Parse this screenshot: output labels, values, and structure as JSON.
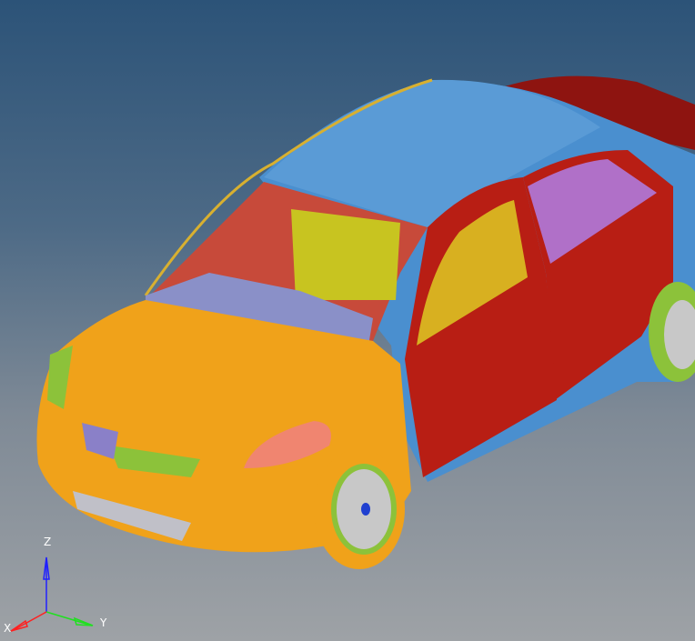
{
  "viewport": {
    "model": "sedan-car-fe-model",
    "colors": {
      "body_side": "#4a8fcf",
      "hood_front": "#f0a21a",
      "doors": "#b81e14",
      "spoiler": "#8e1410",
      "tire": "#f0a21a",
      "rim": "#c8c8c8",
      "headlight": "#f08570",
      "grille_trim": "#8cc23a",
      "rear_glass": "#b070c8",
      "seat": "#c8c420"
    }
  },
  "triad": {
    "x_label": "X",
    "y_label": "Y",
    "z_label": "Z",
    "x_color": "#ff2020",
    "y_color": "#20e020",
    "z_color": "#2020ff"
  }
}
